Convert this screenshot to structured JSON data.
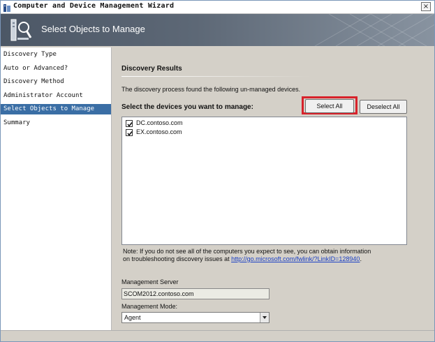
{
  "window": {
    "title": "Computer and Device Management Wizard",
    "close_label": "×"
  },
  "header": {
    "title": "Select Objects to Manage",
    "icon": "wizard-computer-icon"
  },
  "nav": {
    "items": [
      {
        "label": "Discovery Type",
        "selected": false
      },
      {
        "label": "Auto or Advanced?",
        "selected": false
      },
      {
        "label": "Discovery Method",
        "selected": false
      },
      {
        "label": "Administrator Account",
        "selected": false
      },
      {
        "label": "Select Objects to Manage",
        "selected": true
      },
      {
        "label": "Summary",
        "selected": false
      }
    ]
  },
  "main": {
    "section_title": "Discovery Results",
    "description": "The discovery process found the following un-managed devices.",
    "prompt": "Select the devices you want to manage:",
    "select_all_label": "Select All",
    "deselect_all_label": "Deselect All",
    "devices": [
      {
        "name": "DC.contoso.com",
        "checked": true
      },
      {
        "name": "EX.contoso.com",
        "checked": true
      }
    ],
    "note_text": "Note: If you do not see all of the computers you expect to see, you can obtain information on troubleshooting discovery issues at ",
    "note_link": "http://go.microsoft.com/fwlink/?LinkID=128940",
    "note_end": ".",
    "management_server_label": "Management Server",
    "management_server_value": "SCOM2012.contoso.com",
    "management_mode_label": "Management Mode:",
    "management_mode_value": "Agent"
  },
  "colors": {
    "selection": "#3a6ea5",
    "highlight": "#d8222b",
    "link": "#1a3fc4"
  }
}
